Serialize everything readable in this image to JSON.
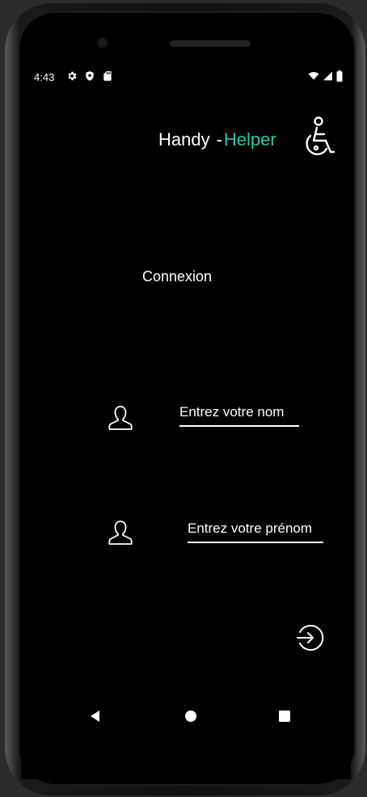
{
  "status_bar": {
    "time": "4:43",
    "left_icons": [
      "settings-icon",
      "shield-icon",
      "sd-card-icon"
    ],
    "right_icons": [
      "wifi-icon",
      "signal-icon",
      "battery-icon"
    ]
  },
  "header": {
    "title_part1": "Handy",
    "title_dash": "-",
    "title_part2": "Helper",
    "logo_icon": "wheelchair-icon",
    "accent_color": "#2ec4a6"
  },
  "login": {
    "heading": "Connexion",
    "name_placeholder": "Entrez votre nom",
    "firstname_placeholder": "Entrez votre prénom",
    "submit_icon": "login-arrow-icon"
  },
  "navigation": [
    "back-icon",
    "home-icon",
    "recents-icon"
  ]
}
